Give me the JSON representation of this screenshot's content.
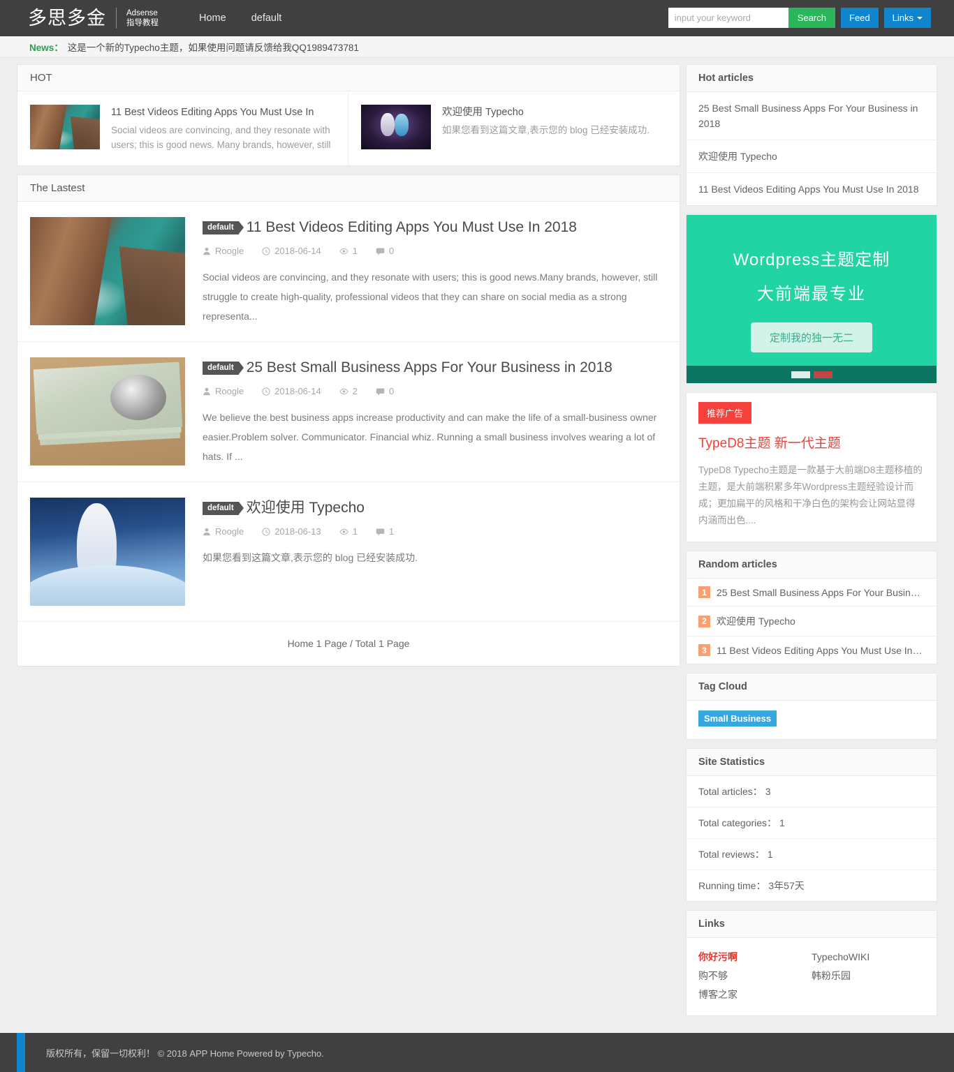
{
  "header": {
    "brand_name": "多思多金",
    "brand_sub_line1": "Adsense",
    "brand_sub_line2": "指导教程",
    "nav": [
      {
        "label": "Home"
      },
      {
        "label": "default"
      }
    ],
    "search_placeholder": "input your keyword",
    "search_value": "",
    "search_button": "Search",
    "feed_button": "Feed",
    "links_button": "Links",
    "colors": {
      "bar": "#404040",
      "search": "#2bb65c",
      "feed": "#0e85cd"
    }
  },
  "news": {
    "label": "News：",
    "text": "这是一个新的Typecho主题，如果使用问题请反馈给我QQ1989473781"
  },
  "hot": {
    "title": "HOT",
    "items": [
      {
        "title": "11 Best Videos Editing Apps You Must Use In",
        "desc": "Social videos are convincing, and they resonate with users; this is good news. Many brands, however, still",
        "thumb": "cliff-coast-photo"
      },
      {
        "title": "欢迎使用 Typecho",
        "desc": "如果您看到这篇文章,表示您的 blog 已经安装成功.",
        "thumb": "anime-square-photo"
      }
    ]
  },
  "latest": {
    "title": "The Lastest",
    "posts": [
      {
        "category": "default",
        "title": "11 Best Videos Editing Apps You Must Use In 2018",
        "author": "Roogle",
        "date": "2018-06-14",
        "views": "1",
        "comments": "0",
        "excerpt": "Social videos are convincing, and they resonate with users; this is good news.Many brands, however, still struggle to create high-quality, professional videos that they can share on social media as a strong representa...",
        "thumb": "cliff-coast-photo"
      },
      {
        "category": "default",
        "title": "25 Best Small Business Apps For Your Business in 2018",
        "author": "Roogle",
        "date": "2018-06-14",
        "views": "2",
        "comments": "0",
        "excerpt": "We believe the best business apps increase productivity and can make the life of a small-business owner easier.Problem solver. Communicator. Financial whiz. Running a small business involves wearing a lot of hats. If ...",
        "thumb": "money-stethoscope-photo"
      },
      {
        "category": "default",
        "title": "欢迎使用 Typecho",
        "author": "Roogle",
        "date": "2018-06-13",
        "views": "1",
        "comments": "1",
        "excerpt": "如果您看到这篇文章,表示您的 blog 已经安装成功.",
        "thumb": "anime-girl-photo"
      }
    ],
    "pagination": "Home 1 Page / Total 1 Page"
  },
  "sidebar": {
    "hot_articles": {
      "title": "Hot articles",
      "items": [
        "25 Best Small Business Apps For Your Business in 2018",
        "欢迎使用 Typecho",
        "11 Best Videos Editing Apps You Must Use In 2018"
      ]
    },
    "banner": {
      "line1": "Wordpress主题定制",
      "line2": "大前端最专业",
      "button": "定制我的独一无二",
      "bg_color": "#20d4a4",
      "control_color": "#0b7561"
    },
    "ad": {
      "tag": "推荐广告",
      "title": "TypeD8主题 新一代主题",
      "desc": "TypeD8 Typecho主题是一款基于大前端D8主题移植的主题，是大前端积累多年Wordpress主题经验设计而成；更加扁平的风格和干净白色的架构会让网站显得内涵而出色....",
      "tag_color": "#f4413c",
      "title_color": "#f04138"
    },
    "random_articles": {
      "title": "Random articles",
      "items": [
        {
          "num": "1",
          "label": "25 Best Small Business Apps For Your Busines…"
        },
        {
          "num": "2",
          "label": "欢迎使用 Typecho"
        },
        {
          "num": "3",
          "label": "11 Best Videos Editing Apps You Must Use In 2…"
        }
      ]
    },
    "tag_cloud": {
      "title": "Tag Cloud",
      "tags": [
        "Small Business"
      ],
      "tag_color": "#36a8dd"
    },
    "site_statistics": {
      "title": "Site Statistics",
      "items": [
        "Total articles： 3",
        "Total categories： 1",
        "Total reviews： 1",
        "Running time： 3年57天"
      ]
    },
    "links": {
      "title": "Links",
      "items": [
        {
          "label": "你好污啊",
          "highlight": true
        },
        {
          "label": "TypechoWIKI",
          "highlight": false
        },
        {
          "label": "购不够",
          "highlight": false
        },
        {
          "label": "韩粉乐园",
          "highlight": false
        },
        {
          "label": "博客之家",
          "highlight": false
        }
      ]
    }
  },
  "footer": {
    "text": "版权所有，保留一切权利！ © 2018 APP Home Powered by Typecho.",
    "accent_color": "#0e85cd"
  }
}
